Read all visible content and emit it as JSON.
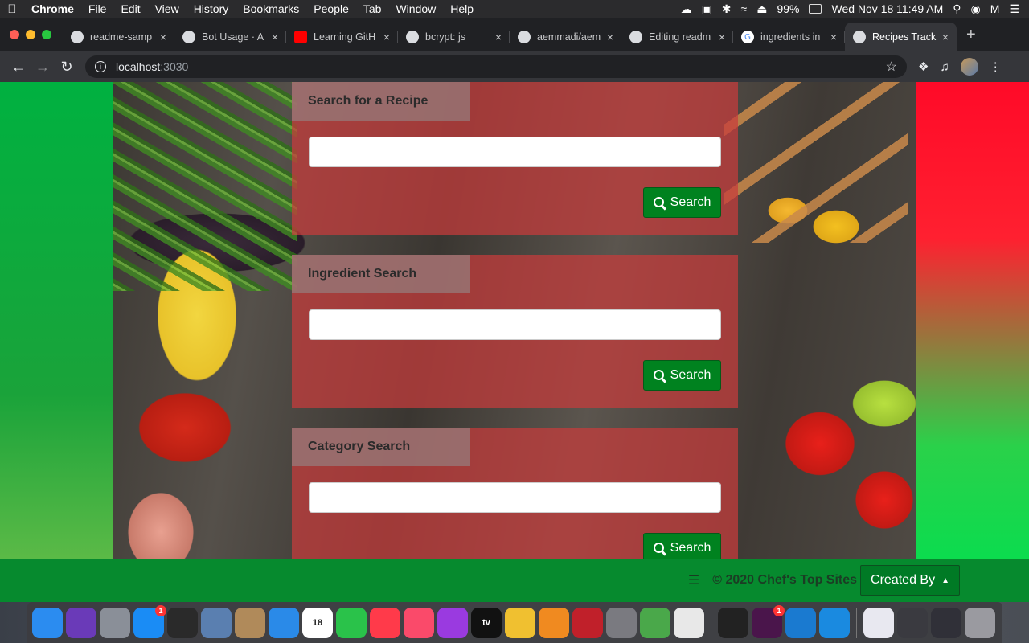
{
  "menubar": {
    "app": "Chrome",
    "items": [
      "File",
      "Edit",
      "View",
      "History",
      "Bookmarks",
      "People",
      "Tab",
      "Window",
      "Help"
    ],
    "battery": "99%",
    "datetime": "Wed Nov 18  11:49 AM"
  },
  "tabs": [
    {
      "title": "readme-samp",
      "icon": "github-icon"
    },
    {
      "title": "Bot Usage · A",
      "icon": "bot-icon"
    },
    {
      "title": "Learning GitH",
      "icon": "youtube-icon"
    },
    {
      "title": "bcrypt: js",
      "icon": "globe-icon"
    },
    {
      "title": "aemmadi/aem",
      "icon": "github-icon"
    },
    {
      "title": "Editing readm",
      "icon": "github-icon"
    },
    {
      "title": "ingredients in",
      "icon": "google-icon"
    },
    {
      "title": "Recipes Track",
      "icon": "globe-icon",
      "active": true
    }
  ],
  "address": {
    "host": "localhost",
    "port": ":3030"
  },
  "panels": [
    {
      "title": "Search for a Recipe",
      "input_value": "",
      "button": "Search"
    },
    {
      "title": "Ingredient Search",
      "input_value": "",
      "button": "Search"
    },
    {
      "title": "Category Search",
      "input_value": "",
      "button": "Search"
    }
  ],
  "footer": {
    "copyright": "© 2020 Chef's Top Sites",
    "created_by": "Created By"
  },
  "dock": {
    "apps": [
      {
        "name": "Finder",
        "color": "#2b8cf0"
      },
      {
        "name": "Siri",
        "color": "#6a3ab8"
      },
      {
        "name": "Launchpad",
        "color": "#8a8f98"
      },
      {
        "name": "App Store",
        "color": "#1a8cf5",
        "badge": "1"
      },
      {
        "name": "Mission Control",
        "color": "#2a2a2a"
      },
      {
        "name": "Mail",
        "color": "#5a7fb0"
      },
      {
        "name": "Contacts",
        "color": "#b08a5a"
      },
      {
        "name": "Safari",
        "color": "#2a8ae8"
      },
      {
        "name": "Calendar",
        "color": "#ffffff",
        "label": "18"
      },
      {
        "name": "FaceTime",
        "color": "#2ac24a"
      },
      {
        "name": "News",
        "color": "#ff3a4a"
      },
      {
        "name": "Music",
        "color": "#fa4a6a"
      },
      {
        "name": "Podcasts",
        "color": "#9a3ae0"
      },
      {
        "name": "TV",
        "color": "#111111",
        "label": "tv"
      },
      {
        "name": "Photos",
        "color": "#f0c030"
      },
      {
        "name": "Books",
        "color": "#f08a20"
      },
      {
        "name": "Photo Booth",
        "color": "#c0202a"
      },
      {
        "name": "System Preferences",
        "color": "#7a7a80"
      },
      {
        "name": "Maps",
        "color": "#4aa84a"
      },
      {
        "name": "Chrome",
        "color": "#e8e8e8"
      },
      {
        "name": "Terminal",
        "color": "#222222"
      },
      {
        "name": "Slack",
        "color": "#4a154b",
        "badge": "1"
      },
      {
        "name": "VS Code",
        "color": "#1a7ad0"
      },
      {
        "name": "Xcode",
        "color": "#1a8ae0"
      },
      {
        "name": "Document",
        "color": "#e8e8f0"
      },
      {
        "name": "Screen 1",
        "color": "#3a3a40"
      },
      {
        "name": "Screen 2",
        "color": "#303038"
      },
      {
        "name": "Trash",
        "color": "#9a9aa0"
      }
    ]
  }
}
